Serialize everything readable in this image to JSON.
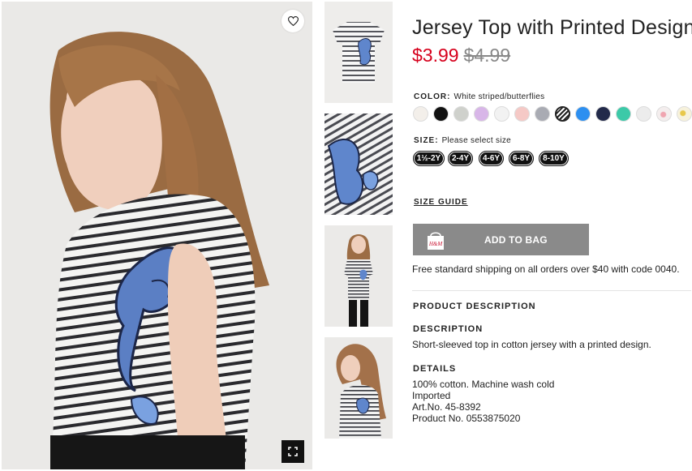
{
  "product": {
    "title": "Jersey Top with Printed Design",
    "price_now": "$3.99",
    "price_old": "$4.99"
  },
  "color": {
    "label": "COLOR:",
    "selected": "White striped/butterflies",
    "swatches": [
      {
        "name": "cream",
        "hex": "#f3efea"
      },
      {
        "name": "black",
        "hex": "#111111"
      },
      {
        "name": "light-grey-green",
        "hex": "#cfd1cc"
      },
      {
        "name": "lilac",
        "hex": "#d8b6e8"
      },
      {
        "name": "white",
        "hex": "#f2f2f2"
      },
      {
        "name": "light-pink",
        "hex": "#f5c9c6"
      },
      {
        "name": "grey",
        "hex": "#a9abb3"
      },
      {
        "name": "striped",
        "hex": "#ffffff"
      },
      {
        "name": "blue",
        "hex": "#2d8ff0"
      },
      {
        "name": "navy",
        "hex": "#222a4a"
      },
      {
        "name": "turquoise",
        "hex": "#3cc9a8"
      },
      {
        "name": "light-grey",
        "hex": "#ececec"
      },
      {
        "name": "floral",
        "hex": "#f4eeee"
      },
      {
        "name": "print-yellow",
        "hex": "#f7f2dc"
      }
    ]
  },
  "size": {
    "label": "SIZE:",
    "hint": "Please select size",
    "options": [
      "1½-2Y",
      "2-4Y",
      "4-6Y",
      "6-8Y",
      "8-10Y"
    ]
  },
  "size_guide": "SIZE GUIDE",
  "add_to_bag": "ADD TO BAG",
  "bag_brand": "H&M",
  "shipping": "Free standard shipping on all orders over $40 with code 0040.",
  "sections": {
    "product_description": "PRODUCT DESCRIPTION",
    "description_head": "DESCRIPTION",
    "description_text": "Short-sleeved top in cotton jersey with a printed design.",
    "details_head": "DETAILS",
    "details": [
      "100% cotton. Machine wash cold",
      "Imported",
      "Art.No. 45-8392",
      "Product No. 0553875020"
    ]
  },
  "icons": {
    "wishlist": "heart-icon",
    "fullscreen": "expand-icon",
    "bag": "shopping-bag-icon"
  },
  "colors": {
    "price_sale": "#d6001c",
    "button_bg": "#8a8a8a"
  }
}
